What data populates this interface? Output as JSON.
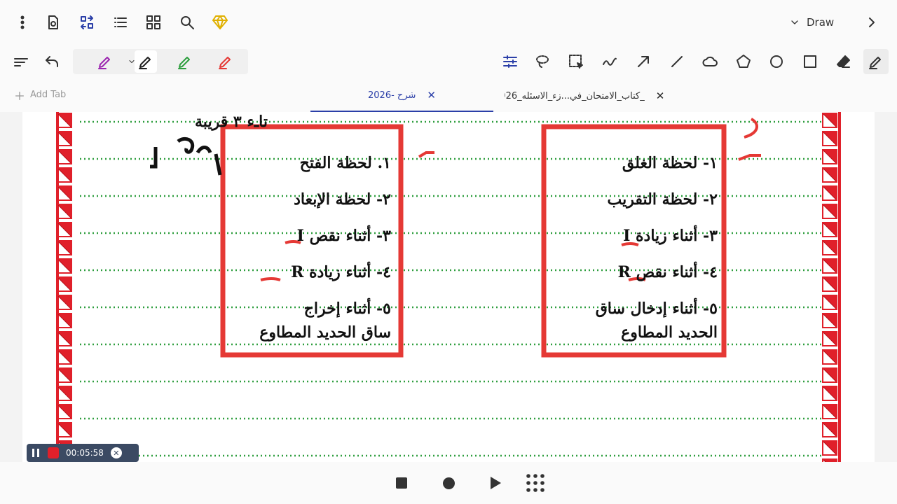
{
  "toolbar": {
    "mode_label": "Draw",
    "icons": [
      "more-vert-icon",
      "settings-doc-icon",
      "swap-icon",
      "list-icon",
      "grid-icon",
      "search-icon",
      "premium-diamond-icon"
    ]
  },
  "tools": {
    "pen_colors": {
      "purple": "#9c27b0",
      "black": "#222222",
      "green": "#2e9e3e",
      "red": "#e53935"
    },
    "items": [
      "adjust-icon",
      "lasso-icon",
      "selection-icon",
      "freehand-icon",
      "arrow-icon",
      "line-icon",
      "cloud-icon",
      "pentagon-icon",
      "circle-icon",
      "square-icon",
      "eraser-icon",
      "pen-icon"
    ]
  },
  "tabs": {
    "add_tab": "Add Tab",
    "tab1": "شرح -2026",
    "tab2": "_كتاب_الامتحان_في...زء_الاسئله_2026"
  },
  "notes": {
    "left_box": [
      "١. لحظة الفتح",
      "٢- لحظة الإبعاد",
      "٣- أثناء نقص I",
      "٤- أثناء زيادة R",
      "٥- أثناء إخراج",
      "ساق الحديد المطاوع"
    ],
    "right_box": [
      "١- لحظة الغلق",
      "٢- لحظة التقريب",
      "٣- أثناء زيادة I",
      "٤- أثناء نقص R",
      "٥- أثناء إدخال ساق",
      "الحديد المطاوع"
    ],
    "top_left_scribble": "تاـء ٣ قريبة",
    "colors": {
      "box": "#e53935",
      "lines": "#2e9e3e",
      "ink": "#111111"
    }
  },
  "recorder": {
    "time": "00:05:58"
  },
  "bottom_controls": [
    "stop-icon",
    "record-icon",
    "play-icon",
    "apps-grid-icon"
  ]
}
